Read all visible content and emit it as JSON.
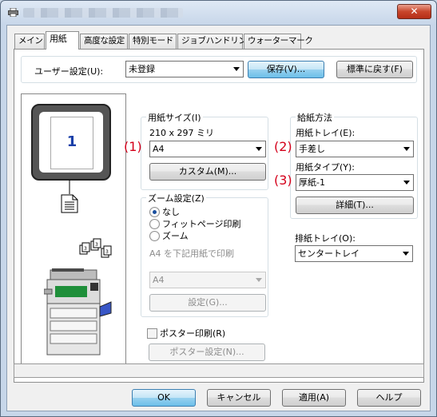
{
  "tabs": [
    "メイン",
    "用紙",
    "高度な設定",
    "特別モード",
    "ジョブハンドリング",
    "ウォーターマーク"
  ],
  "user_settings": {
    "label": "ユーザー設定(U):",
    "value": "未登録",
    "save_label": "保存(V)...",
    "default_label": "標準に戻す(F)"
  },
  "preview": {
    "page_number": "1"
  },
  "paper_size": {
    "title": "用紙サイズ(I)",
    "dimensions": "210 x 297 ミリ",
    "value": "A4",
    "custom_label": "カスタム(M)..."
  },
  "zoom": {
    "title": "ズーム設定(Z)",
    "options": [
      "なし",
      "フィットページ印刷",
      "ズーム"
    ],
    "selected": "なし",
    "fit_text": "A4 を下記用紙で印刷",
    "fit_paper": "A4",
    "settings_label": "設定(G)..."
  },
  "poster": {
    "checkbox_label": "ポスター印刷(R)",
    "settings_label": "ポスター設定(N)..."
  },
  "paper_source": {
    "title": "給紙方法",
    "tray_label": "用紙トレイ(E):",
    "tray_value": "手差し",
    "type_label": "用紙タイプ(Y):",
    "type_value": "厚紙-1",
    "details_label": "詳細(T)..."
  },
  "output_tray": {
    "label": "排紙トレイ(O):",
    "value": "センタートレイ"
  },
  "annotations": [
    "(1)",
    "(2)",
    "(3)"
  ],
  "dialog_buttons": {
    "ok": "OK",
    "cancel": "キャンセル",
    "apply": "適用(A)",
    "help": "ヘルプ"
  },
  "colors": {
    "annotation": "#d4001a",
    "accent": "#3c7fb1",
    "close": "#c8452b"
  }
}
